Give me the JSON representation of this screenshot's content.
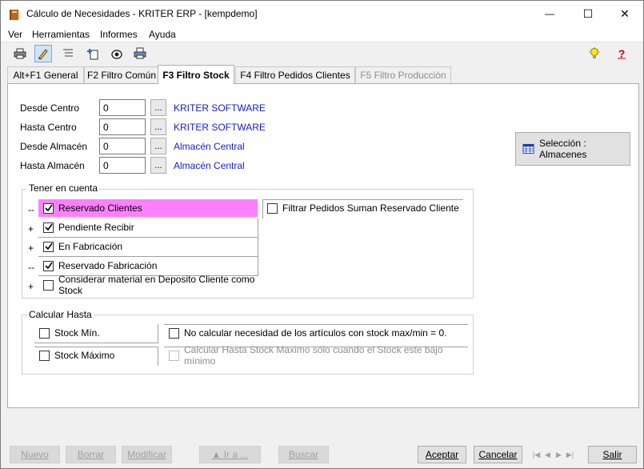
{
  "window": {
    "title": "Cálculo de Necesidades - KRITER ERP - [kempdemo]",
    "minimize_glyph": "—",
    "maximize_glyph": "☐",
    "close_glyph": "✕"
  },
  "menu": [
    "Ver",
    "Herramientas",
    "Informes",
    "Ayuda"
  ],
  "tabs": [
    {
      "label": "Alt+F1 General"
    },
    {
      "label": "F2 Filtro Común"
    },
    {
      "label": "F3 Filtro Stock"
    },
    {
      "label": "F4 Filtro Pedidos Clientes"
    },
    {
      "label": "F5 Filtro Producción"
    }
  ],
  "filters": {
    "desde_centro": {
      "label": "Desde Centro",
      "value": "0",
      "desc": "KRITER SOFTWARE"
    },
    "hasta_centro": {
      "label": "Hasta Centro",
      "value": "0",
      "desc": "KRITER SOFTWARE"
    },
    "desde_almacen": {
      "label": "Desde Almacén",
      "value": "0",
      "desc": "Almacén Central"
    },
    "hasta_almacen": {
      "label": "Hasta Almacén",
      "value": "0",
      "desc": "Almacén Central"
    },
    "dots_label": "..."
  },
  "seleccion_button": "Selección : Almacenes",
  "tener_en_cuenta": {
    "title": "Tener en cuenta",
    "items": [
      {
        "prefix": "--",
        "label": "Reservado Clientes",
        "checked": true
      },
      {
        "prefix": "+",
        "label": "Pendiente Recibir",
        "checked": true
      },
      {
        "prefix": "+",
        "label": "En Fabricación",
        "checked": true
      },
      {
        "prefix": "--",
        "label": "Reservado Fabricación",
        "checked": true
      },
      {
        "prefix": "+",
        "label": "Considerar material en Deposito Cliente como Stock",
        "checked": false
      }
    ],
    "filtrar_pedidos": {
      "label": "Filtrar Pedidos Suman Reservado Cliente",
      "checked": false
    }
  },
  "calcular_hasta": {
    "title": "Calcular Hasta",
    "stock_min": {
      "label": "Stock Mín.",
      "checked": false
    },
    "stock_max": {
      "label": "Stock Máximo",
      "checked": false
    },
    "no_calcular": {
      "label": "No calcular necesidad de los artículos con stock max/min = 0.",
      "checked": false
    },
    "calc_hasta_max": {
      "label": "Calcular Hasta Stock Maximo sólo cuando el Stock este bajo mínimo",
      "checked": false
    }
  },
  "bottom_buttons": {
    "nuevo": "Nuevo",
    "borrar": "Borrar",
    "modificar": "Modificar",
    "ir_a": "▲ Ir a ...",
    "buscar": "Buscar",
    "aceptar": "Aceptar",
    "cancelar": "Cancelar",
    "salir": "Salir"
  },
  "colors": {
    "highlight_row": "#ff80ff",
    "link_text": "#1a1ac8"
  }
}
